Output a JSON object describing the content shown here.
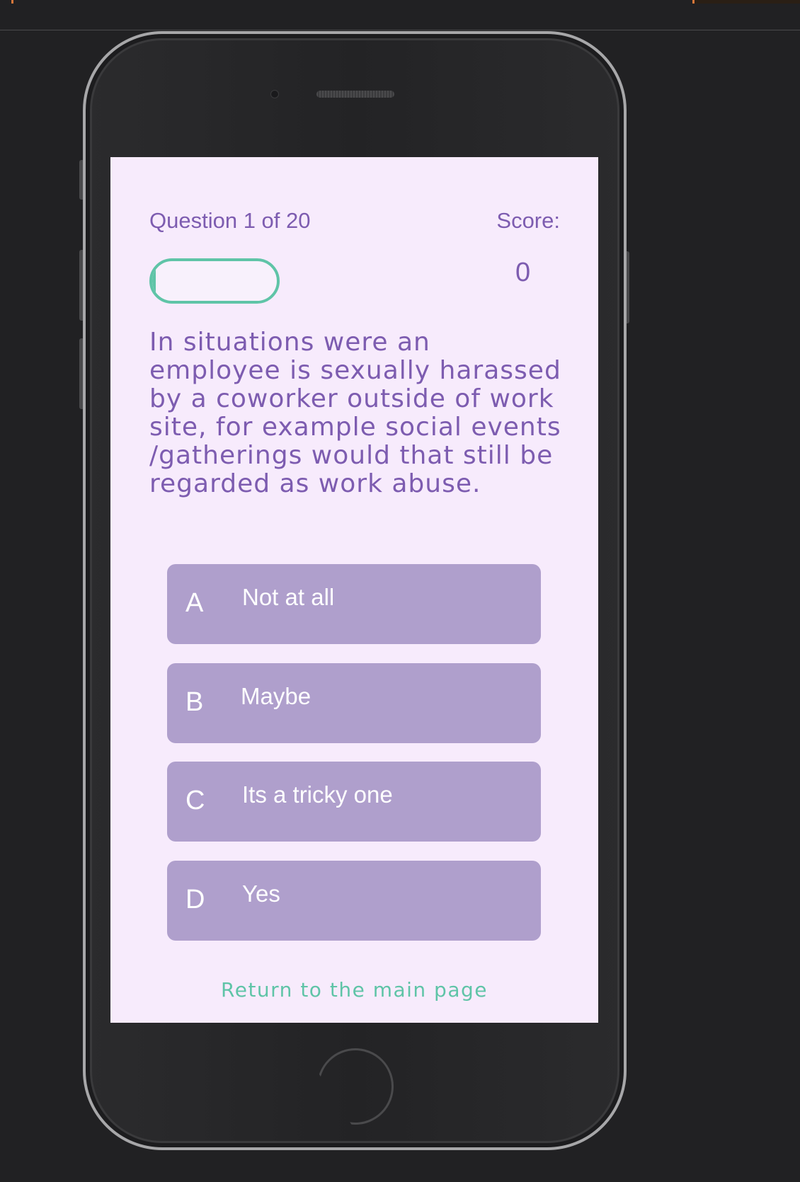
{
  "quiz": {
    "question_counter": "Question 1 of 20",
    "score_label": "Score:",
    "score_value": "0",
    "progress": 0.03,
    "question_text": "In situations were an employee is sexually harassed by a coworker outside of work site, for example social events /gatherings would that still be regarded as work abuse.",
    "options": [
      {
        "letter": "A",
        "text": "Not at all"
      },
      {
        "letter": "B",
        "text": "Maybe"
      },
      {
        "letter": "C",
        "text": "Its a tricky one"
      },
      {
        "letter": "D",
        "text": "Yes"
      }
    ],
    "return_link": "Return to the main page"
  },
  "colors": {
    "background": "#212123",
    "screen": "#f7ebfc",
    "primary_text": "#7d5cb0",
    "accent": "#5fc4a7",
    "option_bg": "#af9fcc",
    "option_text": "#ffffff"
  }
}
